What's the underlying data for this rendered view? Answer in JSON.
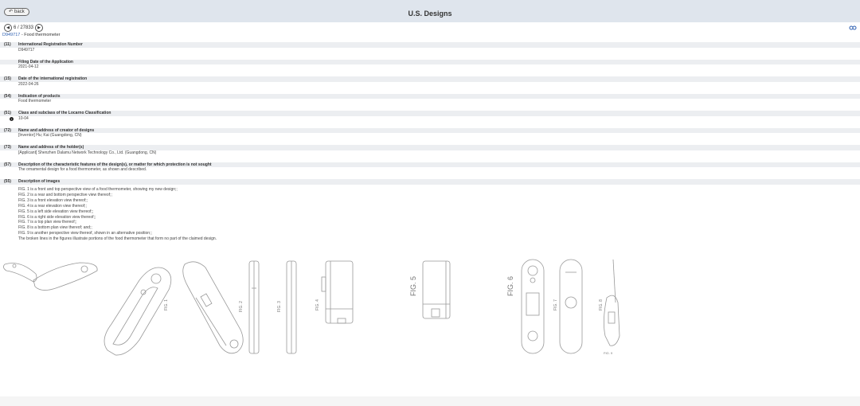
{
  "header": {
    "back_label": "back",
    "title": "U.S. Designs"
  },
  "nav": {
    "position": "6 / 27833"
  },
  "record": {
    "id": "D949717",
    "title": " - Food thermometer"
  },
  "sections": [
    {
      "code": "(11)",
      "label": "International Registration Number",
      "value": "D949717"
    },
    {
      "code": "",
      "label": "Filing Date of the Application",
      "value": "2021-04-12"
    },
    {
      "code": "(15)",
      "label": "Date of the international registration",
      "value": "2022-04-26"
    },
    {
      "code": "(54)",
      "label": "Indication of products",
      "value": "Food thermometer"
    },
    {
      "code": "(51)",
      "label": "Class and subclass of the Locarno Classification",
      "value": "10-04"
    },
    {
      "code": "(72)",
      "label": "Name and address of creator of designs",
      "value": "[Inventor] Hu; Kai (Guangdong, CN)"
    },
    {
      "code": "(73)",
      "label": "Name and address of the holder(s)",
      "value": "[Applicant]  Shenzhen Dalamu Network Technology Co., Ltd. (Guangdong, CN)"
    },
    {
      "code": "(57)",
      "label": "Description of the characteristic features of the design(s), or matter for which protection is not sought",
      "value": "The ornamental design for a food thermometer, as shown and described."
    },
    {
      "code": "(55)",
      "label": "Description of images",
      "value": ""
    }
  ],
  "image_descriptions": [
    "FIG. 1 is a front and top perspective view of a food thermometer, showing my new design;;",
    "FIG. 2 is a rear and bottom perspective view thereof;;",
    "FIG. 3 is a front elevation view thereof;;",
    "FIG. 4 is a rear elevation view thereof;;",
    "FIG. 5 is a left side elevation view thereof;;",
    "FIG. 6 is a right side elevation view thereof;;",
    "FIG. 7 is a top plan view thereof;;",
    "FIG. 8 is a bottom plan view thereof; and;;",
    "FIG. 9 is another perspective view thereof, shown in an alternative position;;",
    "The broken lines in the figures illustrate portions of the food thermometer that form no part of the claimed design."
  ],
  "figures": {
    "fig1": "FIG. 1",
    "fig2": "FIG. 2",
    "fig3": "FIG. 3",
    "fig4": "FIG. 4",
    "fig5": "FIG. 5",
    "fig6": "FIG. 6",
    "fig7": "FIG. 7",
    "fig8": "FIG. 8",
    "fig9": "FIG. 9"
  },
  "icons": {
    "back": "arrow-left-icon",
    "prev": "chevron-left-icon",
    "next": "chevron-right-icon",
    "share": "link-icon",
    "info": "info-icon"
  },
  "colors": {
    "header_bg": "#dfe5ed",
    "section_bg": "#eceef1",
    "link": "#2a5db0"
  }
}
